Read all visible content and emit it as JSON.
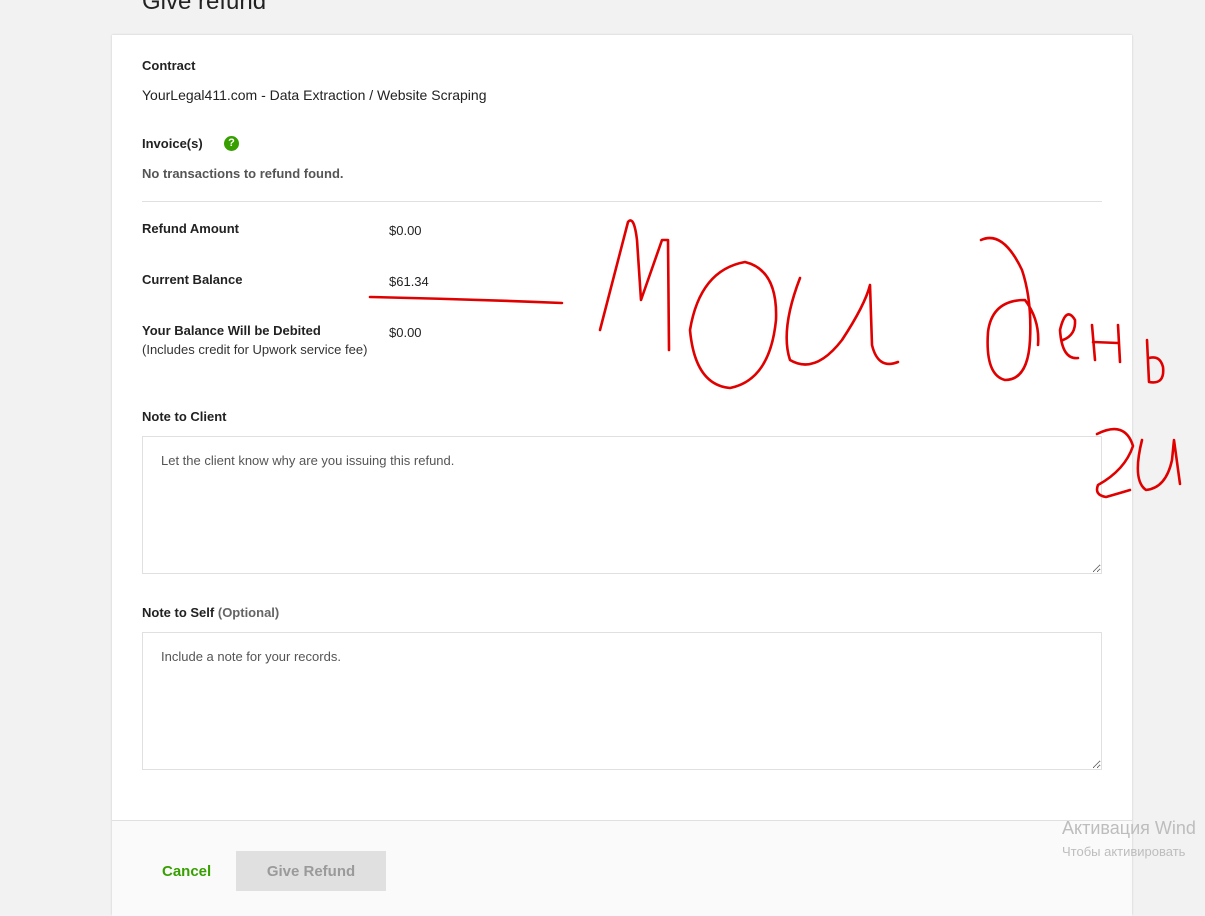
{
  "page": {
    "title": "Give refund"
  },
  "contract": {
    "label": "Contract",
    "name": "YourLegal411.com - Data Extraction / Website Scraping"
  },
  "invoices": {
    "label": "Invoice(s)",
    "help_icon": "question-circle-icon",
    "help_glyph": "?",
    "empty_message": "No transactions to refund found."
  },
  "amounts": {
    "refund_label": "Refund Amount",
    "refund_value": "$0.00",
    "balance_label": "Current Balance",
    "balance_value": "$61.34",
    "debit_label": "Your Balance Will be Debited",
    "debit_note": "(Includes credit for Upwork service fee)",
    "debit_value": "$0.00"
  },
  "note_to_client": {
    "label": "Note to Client",
    "placeholder": "Let the client know why are you issuing this refund."
  },
  "note_to_self": {
    "label": "Note to Self",
    "optional": "(Optional)",
    "placeholder": "Include a note for your records."
  },
  "footer": {
    "cancel_label": "Cancel",
    "submit_label": "Give Refund"
  },
  "watermark": {
    "title": "Активация Wind",
    "subtitle": "Чтобы активировать"
  },
  "annotation": {
    "handwriting": "мои день ги",
    "color": "#e00000"
  },
  "colors": {
    "accent": "#37a000",
    "disabled_button": "#e0e0e0"
  }
}
